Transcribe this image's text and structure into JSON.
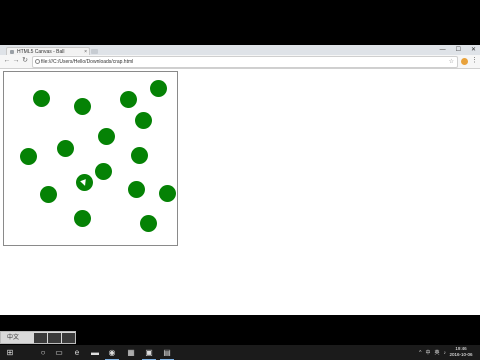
{
  "browser": {
    "tab_title": "HTML5 Canvas - Ball",
    "tab_close": "×",
    "url": "file:///C:/Users/Hello/Downloads/crap.html",
    "window_controls": [
      "—",
      "☐",
      "✕"
    ],
    "nav": {
      "back": "←",
      "forward": "→",
      "reload": "↻"
    },
    "star": "☆",
    "menu": "⋮"
  },
  "canvas": {
    "ball_color": "#058205",
    "ball_count": 16
  },
  "ime_bar": {
    "text": "中文",
    "buttons": [
      "",
      "",
      ""
    ]
  },
  "taskbar": {
    "icons": [
      "windows-icon",
      "search-icon",
      "task-view-icon",
      "edge-icon",
      "file-explorer-icon",
      "store-icon",
      "chrome-icon",
      "app-icon",
      "notepad-icon"
    ],
    "tray": {
      "chevron": "^",
      "lang": "中",
      "ime": "英"
    },
    "clock_time": "19:46",
    "clock_date": "2016-10-06"
  }
}
